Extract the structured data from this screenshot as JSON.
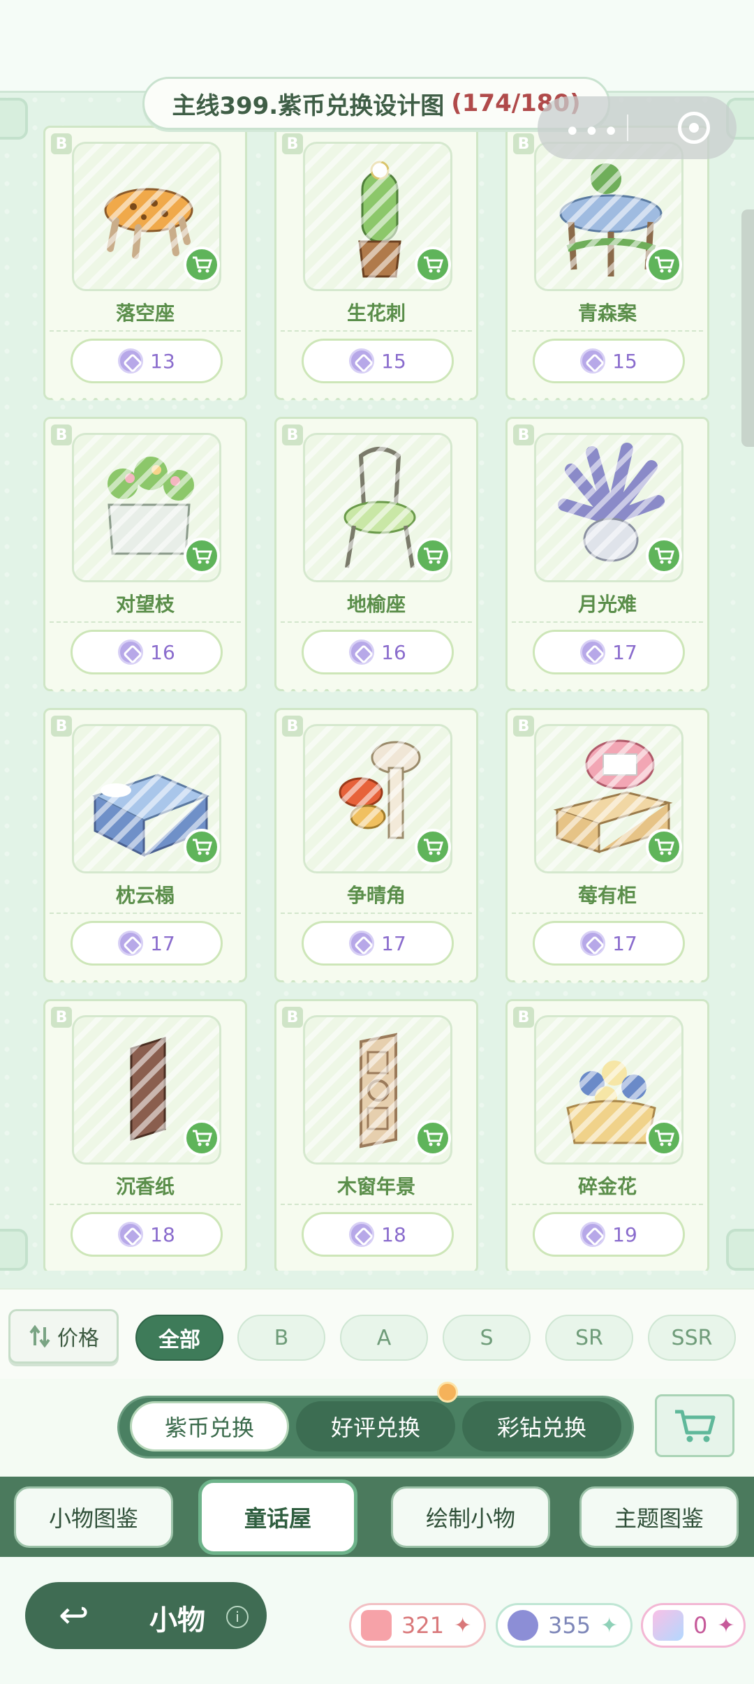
{
  "header": {
    "title": "主线399.紫币兑换设计图",
    "progress": "(174/180)"
  },
  "items": [
    {
      "name": "落空座",
      "rank": "B",
      "price": "13"
    },
    {
      "name": "生花刺",
      "rank": "B",
      "price": "15"
    },
    {
      "name": "青森案",
      "rank": "B",
      "price": "15"
    },
    {
      "name": "对望枝",
      "rank": "B",
      "price": "16"
    },
    {
      "name": "地榆座",
      "rank": "B",
      "price": "16"
    },
    {
      "name": "月光难",
      "rank": "B",
      "price": "17"
    },
    {
      "name": "枕云榻",
      "rank": "B",
      "price": "17"
    },
    {
      "name": "争晴角",
      "rank": "B",
      "price": "17"
    },
    {
      "name": "莓有柜",
      "rank": "B",
      "price": "17"
    },
    {
      "name": "沉香纸",
      "rank": "B",
      "price": "18"
    },
    {
      "name": "木窗年景",
      "rank": "B",
      "price": "18"
    },
    {
      "name": "碎金花",
      "rank": "B",
      "price": "19"
    }
  ],
  "filter": {
    "sort_label": "价格",
    "chips": [
      "全部",
      "B",
      "A",
      "S",
      "SR",
      "SSR"
    ],
    "active": "全部"
  },
  "exchange_tabs": [
    "紫币兑换",
    "好评兑换",
    "彩钻兑换"
  ],
  "categories": [
    "小物图鉴",
    "童话屋",
    "绘制小物",
    "主题图鉴"
  ],
  "bottom": {
    "title": "小物",
    "info": "i",
    "currencies": [
      {
        "icon": "ticket-icon",
        "value": "321",
        "color": "#d9787a"
      },
      {
        "icon": "purple-coin-icon",
        "value": "355",
        "color": "#8a8ad0"
      },
      {
        "icon": "diamond-icon",
        "value": "0",
        "color": "#c65a9a"
      }
    ]
  },
  "colors": {
    "accent_green": "#3e7b59",
    "price_purple": "#8a6ccd",
    "title_red": "#b04a4a"
  }
}
